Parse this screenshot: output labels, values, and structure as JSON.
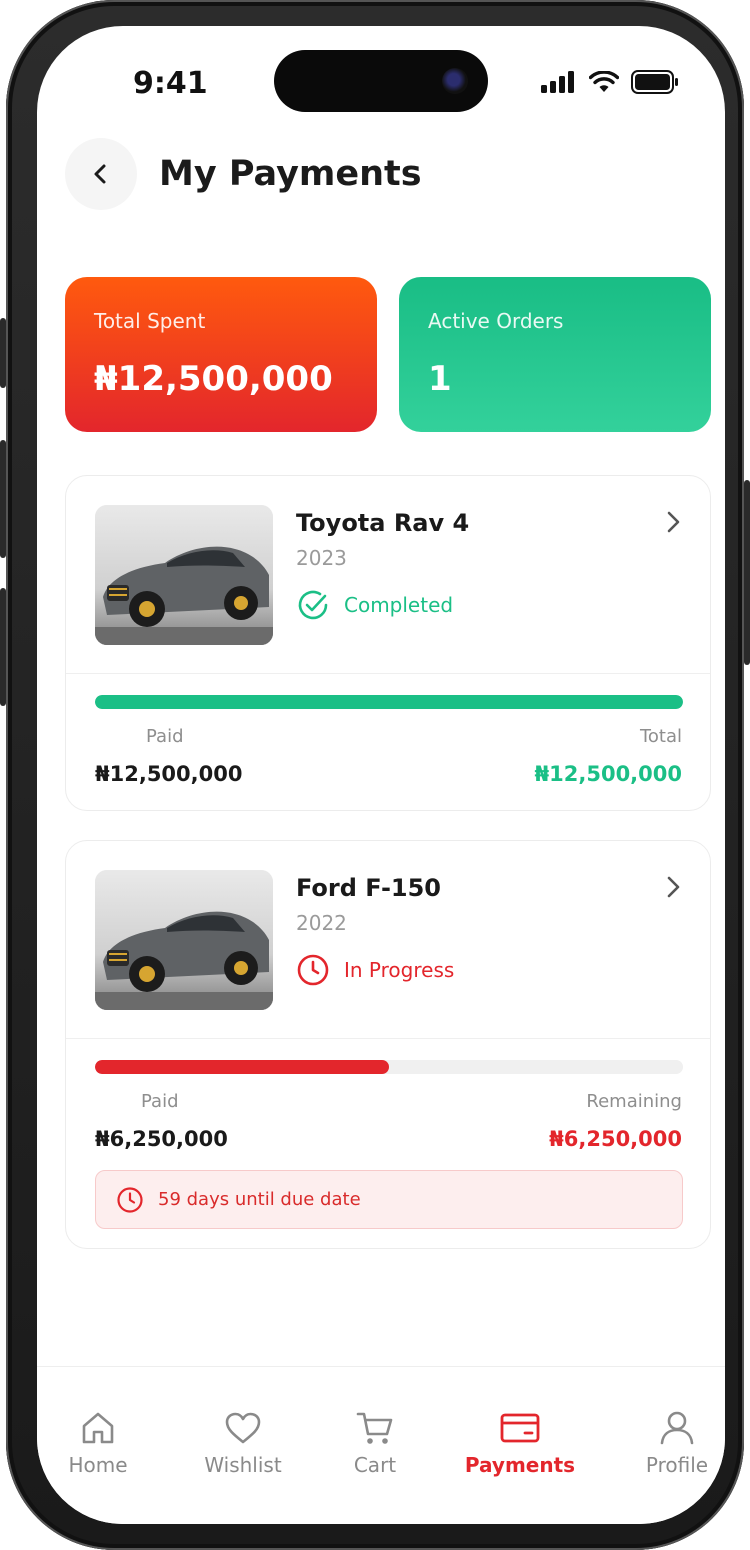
{
  "status_bar": {
    "time": "9:41"
  },
  "header": {
    "title": "My Payments"
  },
  "summary": {
    "total_spent_label": "Total Spent",
    "total_spent_value": "₦12,500,000",
    "active_orders_label": "Active Orders",
    "active_orders_value": "1"
  },
  "orders": [
    {
      "name": "Toyota Rav 4",
      "year": "2023",
      "status": "Completed",
      "paid_label": "Paid",
      "paid_value": "₦12,500,000",
      "right_label": "Total",
      "right_value": "₦12,500,000",
      "progress_fraction": 1.0
    },
    {
      "name": "Ford F-150",
      "year": "2022",
      "status": "In Progress",
      "paid_label": "Paid",
      "paid_value": "₦6,250,000",
      "right_label": "Remaining",
      "right_value": "₦6,250,000",
      "progress_fraction": 0.5,
      "due_notice": "59 days until due date"
    }
  ],
  "tabbar": {
    "items": [
      {
        "label": "Home",
        "icon": "home-icon"
      },
      {
        "label": "Wishlist",
        "icon": "heart-icon"
      },
      {
        "label": "Cart",
        "icon": "cart-icon"
      },
      {
        "label": "Payments",
        "icon": "card-icon",
        "active": true
      },
      {
        "label": "Profile",
        "icon": "user-icon"
      }
    ]
  },
  "colors": {
    "accent_red": "#e3262c",
    "accent_green": "#1bbf86",
    "orange": "#ff5a0e"
  }
}
